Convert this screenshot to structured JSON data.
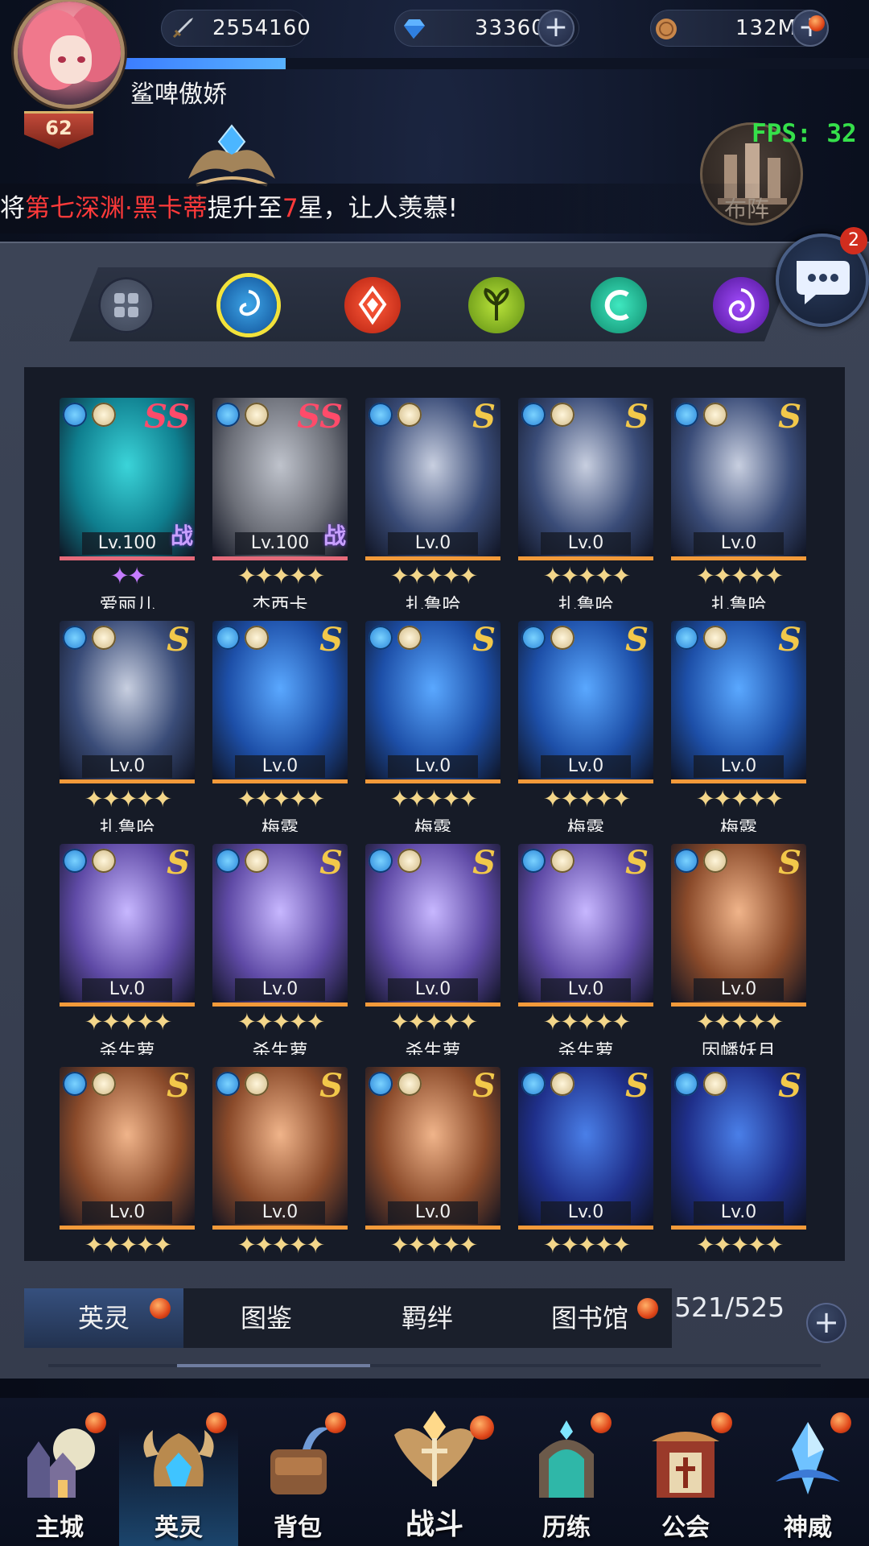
{
  "top": {
    "power": "2554160",
    "diamonds": "33360",
    "coins": "132M",
    "plus": "+",
    "xp_progress": 0.22
  },
  "player": {
    "name": "鲨啤傲娇",
    "level": "62"
  },
  "fps": "FPS: 32",
  "formation_label": "布阵",
  "marquee": {
    "p1": "将",
    "p2": "第七深渊·黑卡蒂",
    "p3": "提升至",
    "p4": "7",
    "p5": "星，让人羡慕!"
  },
  "chat_badge": "2",
  "filters": [
    "all-icon",
    "water-element-icon",
    "fire-element-icon",
    "wind-element-icon",
    "light-element-icon",
    "dark-element-icon"
  ],
  "heroes": [
    {
      "name": "爱丽儿",
      "level": "Lv.100",
      "rank": "SS",
      "stars": "✦✦",
      "zhan": "战"
    },
    {
      "name": "杰西卡",
      "level": "Lv.100",
      "rank": "SS",
      "stars": "✦✦✦✦✦",
      "zhan": "战"
    },
    {
      "name": "扎鲁哈",
      "level": "Lv.0",
      "rank": "S",
      "stars": "✦✦✦✦✦"
    },
    {
      "name": "扎鲁哈",
      "level": "Lv.0",
      "rank": "S",
      "stars": "✦✦✦✦✦"
    },
    {
      "name": "扎鲁哈",
      "level": "Lv.0",
      "rank": "S",
      "stars": "✦✦✦✦✦"
    },
    {
      "name": "扎鲁哈",
      "level": "Lv.0",
      "rank": "S",
      "stars": "✦✦✦✦✦"
    },
    {
      "name": "梅露",
      "level": "Lv.0",
      "rank": "S",
      "stars": "✦✦✦✦✦"
    },
    {
      "name": "梅露",
      "level": "Lv.0",
      "rank": "S",
      "stars": "✦✦✦✦✦"
    },
    {
      "name": "梅露",
      "level": "Lv.0",
      "rank": "S",
      "stars": "✦✦✦✦✦"
    },
    {
      "name": "梅露",
      "level": "Lv.0",
      "rank": "S",
      "stars": "✦✦✦✦✦"
    },
    {
      "name": "杀生萝",
      "level": "Lv.0",
      "rank": "S",
      "stars": "✦✦✦✦✦"
    },
    {
      "name": "杀生萝",
      "level": "Lv.0",
      "rank": "S",
      "stars": "✦✦✦✦✦"
    },
    {
      "name": "杀生萝",
      "level": "Lv.0",
      "rank": "S",
      "stars": "✦✦✦✦✦"
    },
    {
      "name": "杀生萝",
      "level": "Lv.0",
      "rank": "S",
      "stars": "✦✦✦✦✦"
    },
    {
      "name": "因幡妖月",
      "level": "Lv.0",
      "rank": "S",
      "stars": "✦✦✦✦✦"
    },
    {
      "name": "",
      "level": "Lv.0",
      "rank": "S",
      "stars": "✦✦✦✦✦"
    },
    {
      "name": "",
      "level": "Lv.0",
      "rank": "S",
      "stars": "✦✦✦✦✦"
    },
    {
      "name": "",
      "level": "Lv.0",
      "rank": "S",
      "stars": "✦✦✦✦✦"
    },
    {
      "name": "",
      "level": "Lv.0",
      "rank": "S",
      "stars": "✦✦✦✦✦"
    },
    {
      "name": "",
      "level": "Lv.0",
      "rank": "S",
      "stars": "✦✦✦✦✦"
    }
  ],
  "tabs": {
    "heroes": "英灵",
    "codex": "图鉴",
    "bonds": "羁绊",
    "library": "图书馆"
  },
  "hero_count": "521/525",
  "nav": {
    "main_city": "主城",
    "heroes": "英灵",
    "bag": "背包",
    "battle": "战斗",
    "trials": "历练",
    "guild": "公会",
    "divine": "神威"
  },
  "colors": {
    "accent_blue": "#3b7cff",
    "rank_s": "#f2c84a",
    "rank_ss": "#ff4b6a",
    "marquee_red": "#ff3a3a",
    "fps_green": "#35e04a"
  }
}
